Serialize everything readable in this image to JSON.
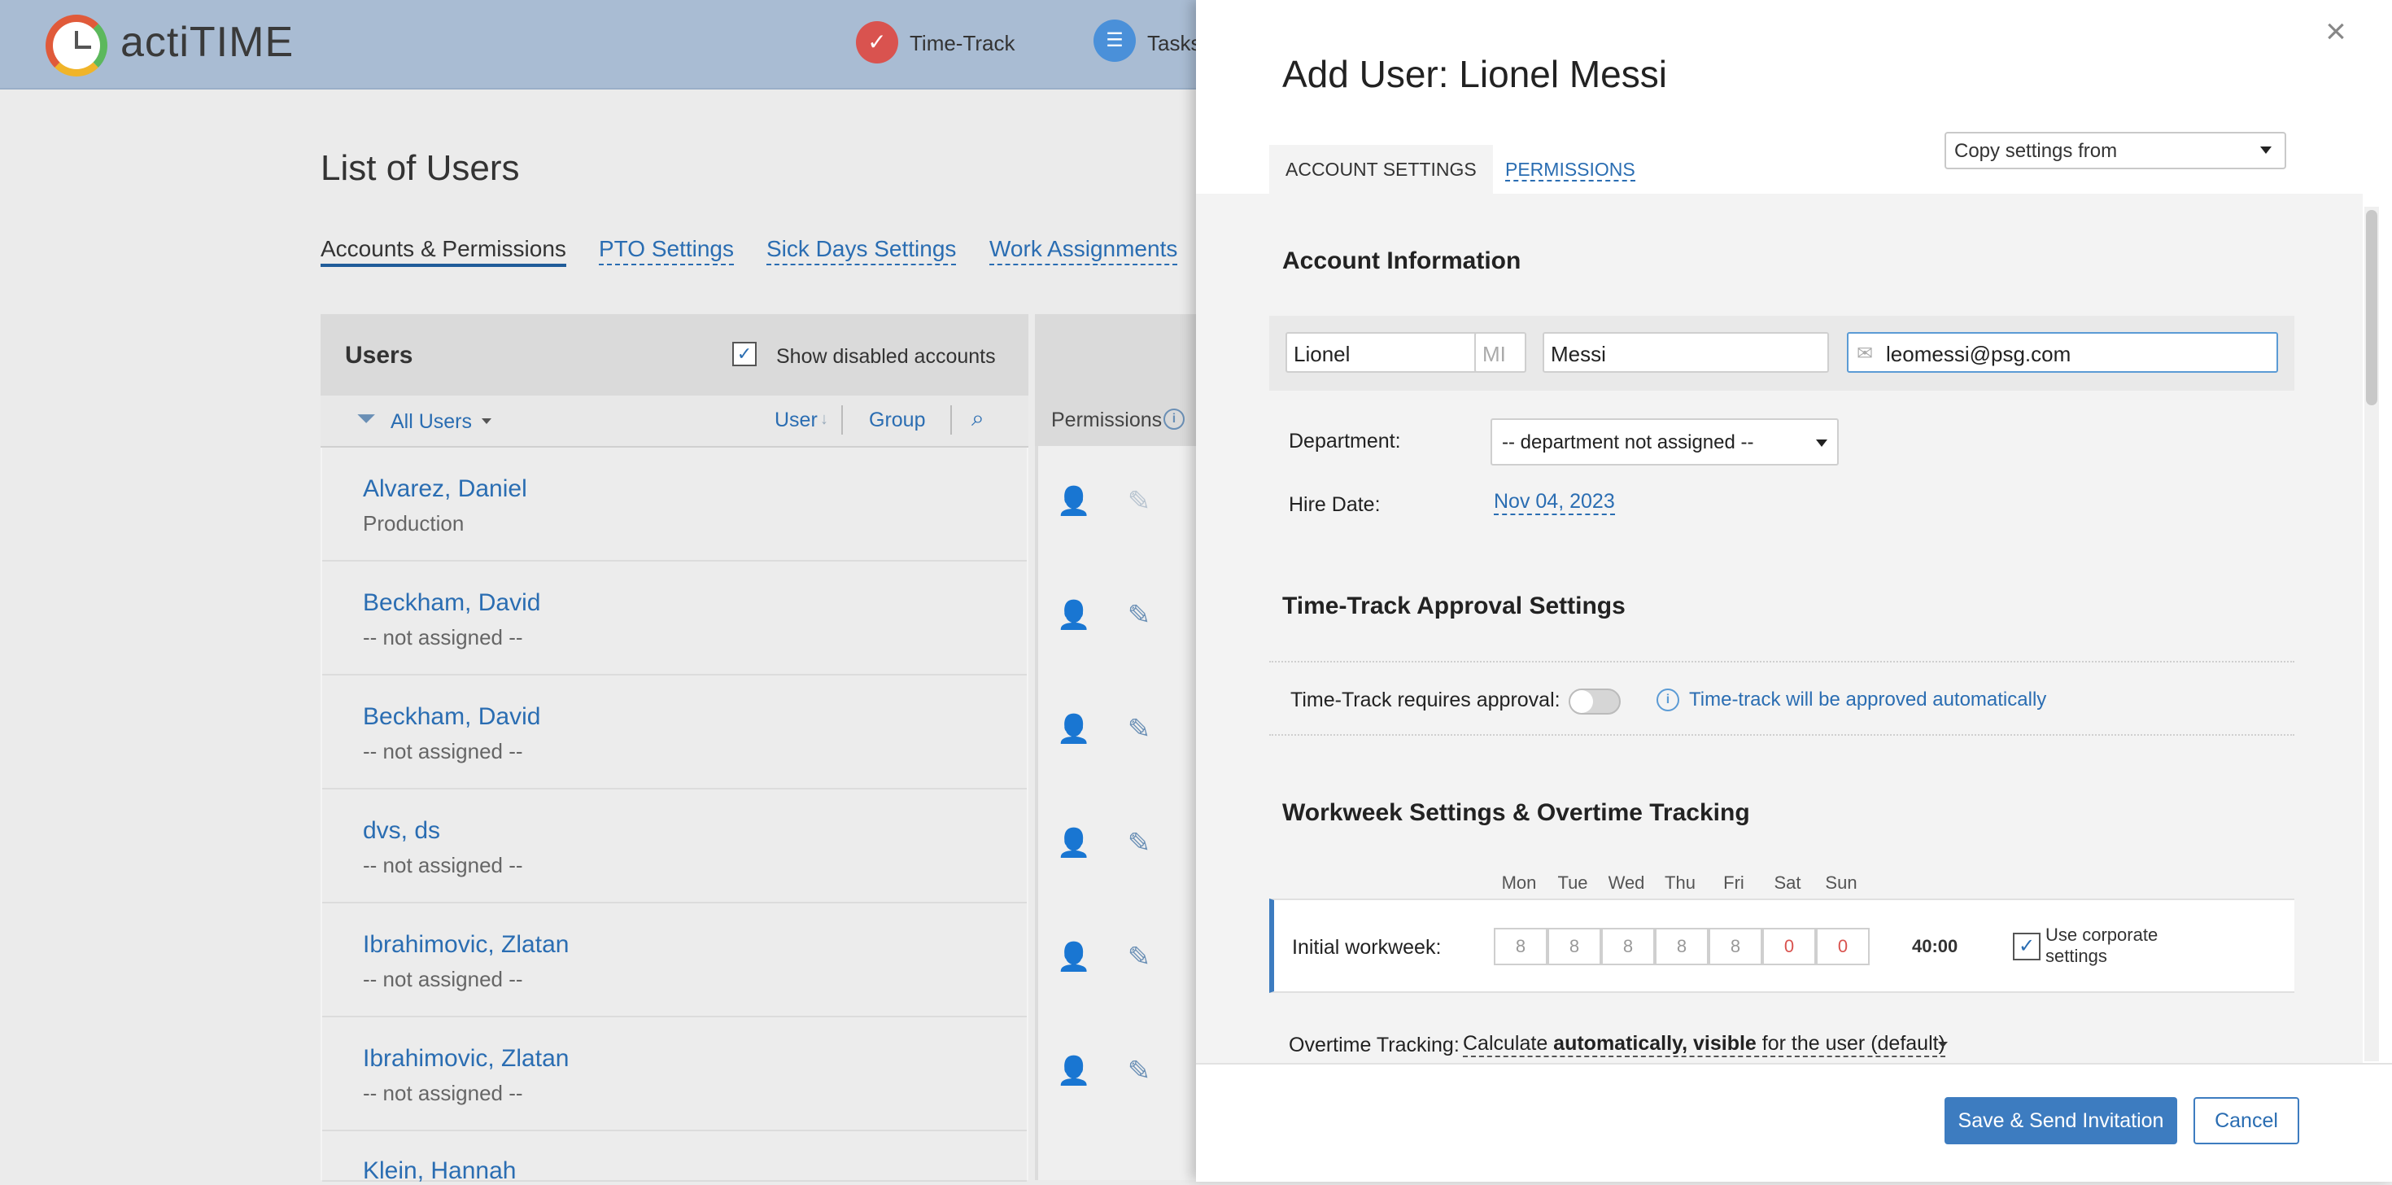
{
  "app": {
    "logo_text": "actiTIME"
  },
  "topnav": [
    {
      "label": "Time-Track",
      "icon": "checkmark-icon",
      "color": "#d9534f"
    },
    {
      "label": "Tasks",
      "icon": "list-icon",
      "color": "#4a90d9"
    }
  ],
  "page": {
    "title": "List of Users",
    "tabs": [
      "Accounts & Permissions",
      "PTO Settings",
      "Sick Days Settings",
      "Work Assignments"
    ],
    "users_header": "Users",
    "show_disabled_label": "Show disabled accounts",
    "filter_label": "All Users",
    "sort_user": "User",
    "sort_group": "Group",
    "permissions_label": "Permissions",
    "users": [
      {
        "name": "Alvarez, Daniel",
        "dept": "Production"
      },
      {
        "name": "Beckham, David",
        "dept": "-- not assigned --"
      },
      {
        "name": "Beckham, David",
        "dept": "-- not assigned --"
      },
      {
        "name": "dvs, ds",
        "dept": "-- not assigned --"
      },
      {
        "name": "Ibrahimovic, Zlatan",
        "dept": "-- not assigned --"
      },
      {
        "name": "Ibrahimovic, Zlatan",
        "dept": "-- not assigned --"
      },
      {
        "name": "Klein, Hannah",
        "dept": ""
      }
    ]
  },
  "modal": {
    "title": "Add User: Lionel Messi",
    "tabs": {
      "account": "ACCOUNT SETTINGS",
      "permissions": "PERMISSIONS"
    },
    "copy_settings": "Copy settings from",
    "account_info_title": "Account Information",
    "first_name": "Lionel",
    "mi_placeholder": "MI",
    "last_name": "Messi",
    "email": "leomessi@psg.com",
    "department_label": "Department:",
    "department_value": "-- department not assigned --",
    "hire_date_label": "Hire Date:",
    "hire_date": "Nov 04, 2023",
    "approval_title": "Time-Track Approval Settings",
    "approval_label": "Time-Track requires approval:",
    "approval_info": "Time-track will be approved automatically",
    "workweek_title": "Workweek Settings & Overtime Tracking",
    "days": [
      "Mon",
      "Tue",
      "Wed",
      "Thu",
      "Fri",
      "Sat",
      "Sun"
    ],
    "hours": [
      "8",
      "8",
      "8",
      "8",
      "8",
      "0",
      "0"
    ],
    "workweek_label": "Initial workweek:",
    "workweek_total": "40:00",
    "corporate_label_1": "Use corporate",
    "corporate_label_2": "settings",
    "overtime_label": "Overtime Tracking:",
    "overtime_pre": "Calculate ",
    "overtime_bold1": "automatically",
    "overtime_mid": ", ",
    "overtime_bold2": "visible",
    "overtime_post": " for the user (default)",
    "save_button": "Save & Send Invitation",
    "cancel_button": "Cancel"
  }
}
